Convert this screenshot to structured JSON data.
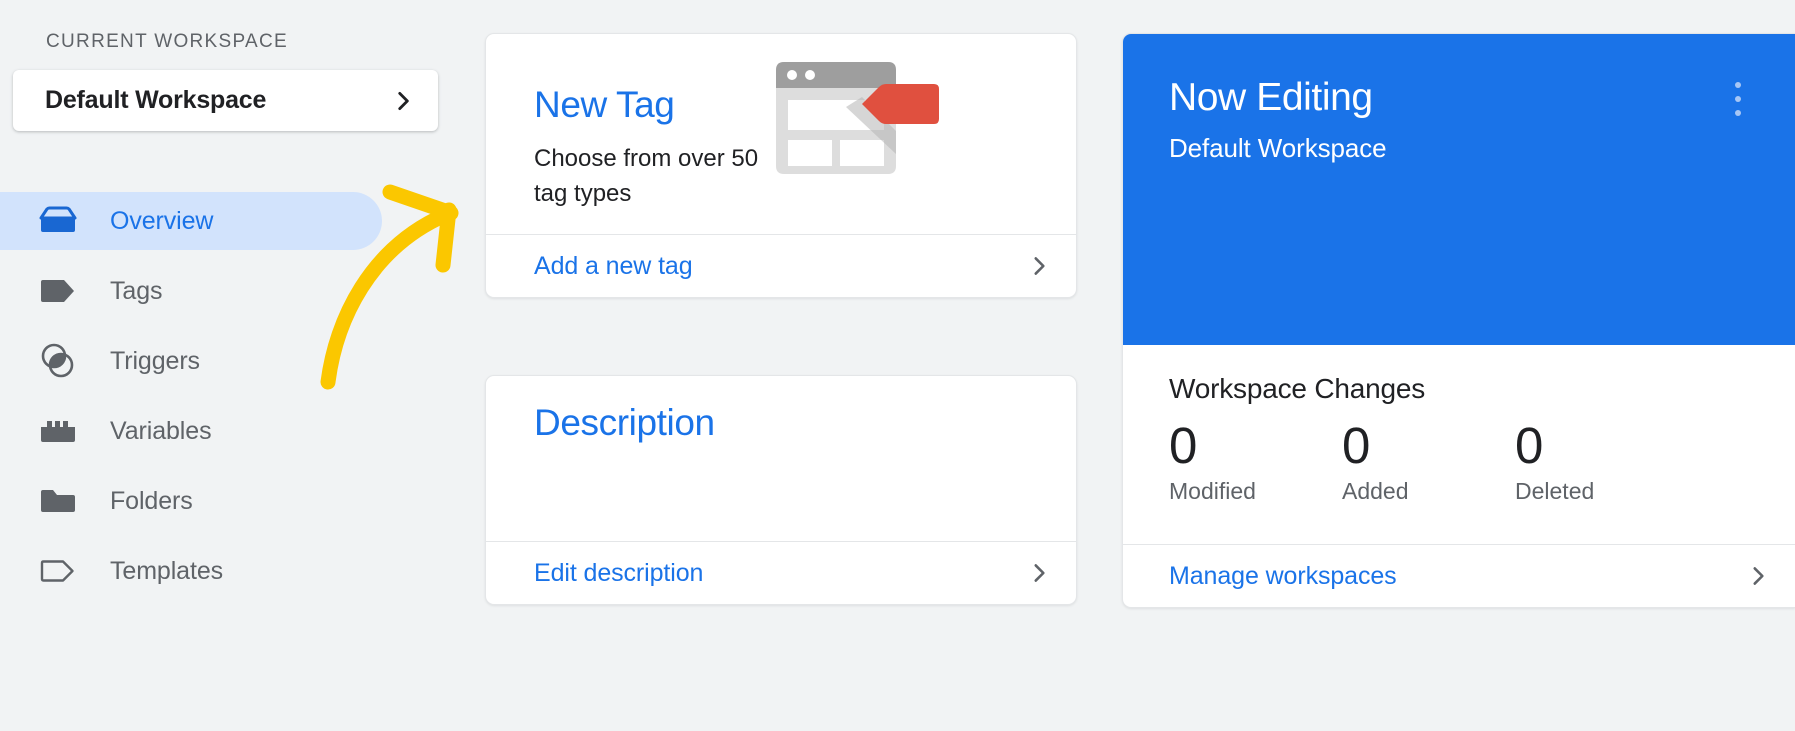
{
  "colors": {
    "accent_blue": "#1a73e8",
    "active_nav_bg": "#d2e3fc",
    "page_bg": "#f1f3f4",
    "card_bg": "#ffffff",
    "text_primary": "#202124",
    "text_secondary": "#5f6368",
    "annotation_yellow": "#fbc700",
    "tag_red": "#e0503f",
    "illustration_grey": "#9e9e9e",
    "illustration_light_grey": "#dddddd"
  },
  "sidebar": {
    "section_label": "CURRENT WORKSPACE",
    "workspace_selector": {
      "name": "Default Workspace",
      "chevron_icon": "chevron-right-icon"
    },
    "items": [
      {
        "label": "Overview",
        "icon": "overview-box-icon",
        "active": true
      },
      {
        "label": "Tags",
        "icon": "tag-filled-icon",
        "active": false
      },
      {
        "label": "Triggers",
        "icon": "triggers-circles-icon",
        "active": false
      },
      {
        "label": "Variables",
        "icon": "variables-brick-icon",
        "active": false
      },
      {
        "label": "Folders",
        "icon": "folder-filled-icon",
        "active": false
      },
      {
        "label": "Templates",
        "icon": "tag-outline-icon",
        "active": false
      }
    ]
  },
  "cards": {
    "new_tag": {
      "title": "New Tag",
      "subtitle": "Choose from over 50 tag types",
      "illustration_icon": "browser-window-with-tag-illustration",
      "footer_label": "Add a new tag",
      "footer_chevron_icon": "chevron-right-icon"
    },
    "description": {
      "title": "Description",
      "footer_label": "Edit description",
      "footer_chevron_icon": "chevron-right-icon"
    }
  },
  "workspace_panel": {
    "title": "Now Editing",
    "subtitle": "Default Workspace",
    "menu_icon": "more-vert-icon",
    "changes_heading": "Workspace Changes",
    "stats": [
      {
        "value": "0",
        "label": "Modified"
      },
      {
        "value": "0",
        "label": "Added"
      },
      {
        "value": "0",
        "label": "Deleted"
      }
    ],
    "footer_label": "Manage workspaces",
    "footer_chevron_icon": "chevron-right-icon"
  },
  "annotation": {
    "type": "curved-arrow",
    "color": "#fbc700",
    "points_to": "New Tag card"
  }
}
